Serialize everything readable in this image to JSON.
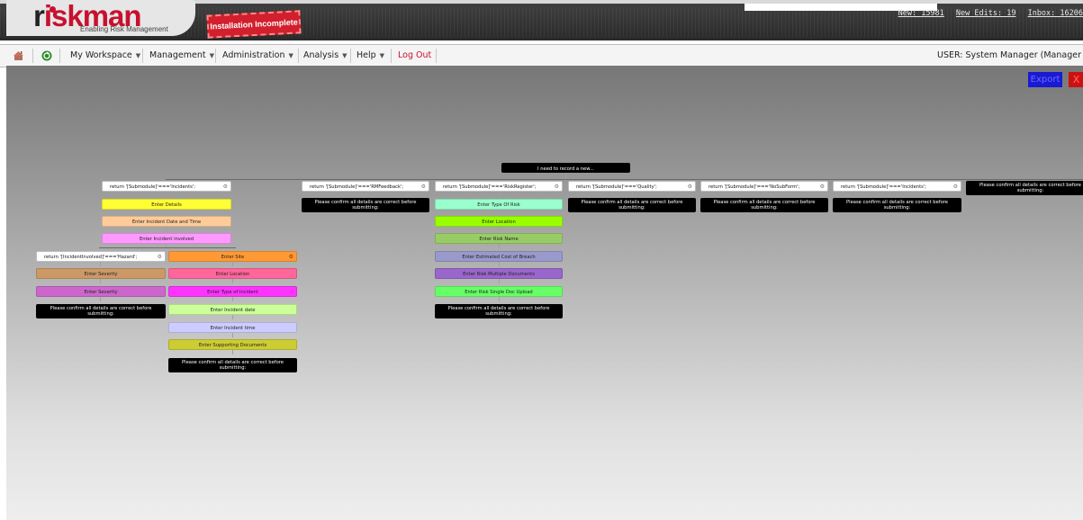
{
  "header": {
    "logo_r": "r",
    "logo_rest": "iskman",
    "logo_tagline": "Enabling Risk Management",
    "install_stamp": "Installation Incomplete",
    "counter_new": "New: 15981",
    "counter_new_edits": "New Edits: 19",
    "counter_inbox": "Inbox: 16206"
  },
  "menu": {
    "items": [
      {
        "label": "My Workspace"
      },
      {
        "label": "Management"
      },
      {
        "label": "Administration"
      },
      {
        "label": "Analysis"
      },
      {
        "label": "Help"
      }
    ],
    "logout": "Log Out",
    "user": "USER: System Manager (Manager"
  },
  "toolbar": {
    "export": "Export",
    "close": "X"
  },
  "flow": {
    "root": "I need to record a new...",
    "col1": {
      "cond": "return '[Submodule]'==='Incidents';",
      "steps": [
        "Enter Details",
        "Enter Incident Date and Time",
        "Enter Incident involved"
      ],
      "left": {
        "cond": "return '[IncidentInvolved]'==='Hazard';",
        "steps": [
          "Enter Severity",
          "Enter Severity"
        ],
        "final": "Please confirm all details are correct before submitting:"
      },
      "right": {
        "cond": "Enter Site",
        "steps": [
          "Enter Location",
          "Enter Type of Incident",
          "Enter Incident date",
          "Enter Incident time",
          "Enter Supporting Documents"
        ],
        "final": "Please confirm all details are correct before submitting:"
      }
    },
    "col2": {
      "cond": "return '[Submodule]'==='RMFeedback';",
      "final": "Please confirm all details are correct before submitting:"
    },
    "col3": {
      "cond": "return '[Submodule]'==='RiskRegister';",
      "steps": [
        "Enter Type Of Risk",
        "Enter Location",
        "Enter Risk Name",
        "Enter Estimated Cost of Breach",
        "Enter Risk Multiple Documents",
        "Enter Risk Single Doc Upload"
      ],
      "final": "Please confirm all details are correct before submitting:"
    },
    "col4": {
      "cond": "return '[Submodule]'==='Quality';",
      "final": "Please confirm all details are correct before submitting:"
    },
    "col5": {
      "cond": "return '[Submodule]'==='NoSubForm';",
      "final": "Please confirm all details are correct before submitting:"
    },
    "col6": {
      "cond": "return '[Submodule]'==='Incidents';",
      "final": "Please confirm all details are correct before submitting:"
    },
    "col7": {
      "final": "Please confirm all details are correct before submitting:"
    },
    "colors": {
      "details": "#ffff33",
      "date_time": "#ffcc99",
      "involved": "#ff99ff",
      "severity1": "#cc9966",
      "severity2": "#cc66cc",
      "site": "#ff9933",
      "location": "#ff6699",
      "type_of_incident": "#ff33ff",
      "incident_date": "#ccff99",
      "incident_time": "#ccccff",
      "supporting_docs": "#cccc33",
      "type_of_risk": "#99ffcc",
      "risk_location": "#99ff00",
      "risk_name": "#99cc66",
      "est_cost": "#9999cc",
      "multiple_docs": "#9966cc",
      "single_doc": "#66ff66"
    }
  }
}
